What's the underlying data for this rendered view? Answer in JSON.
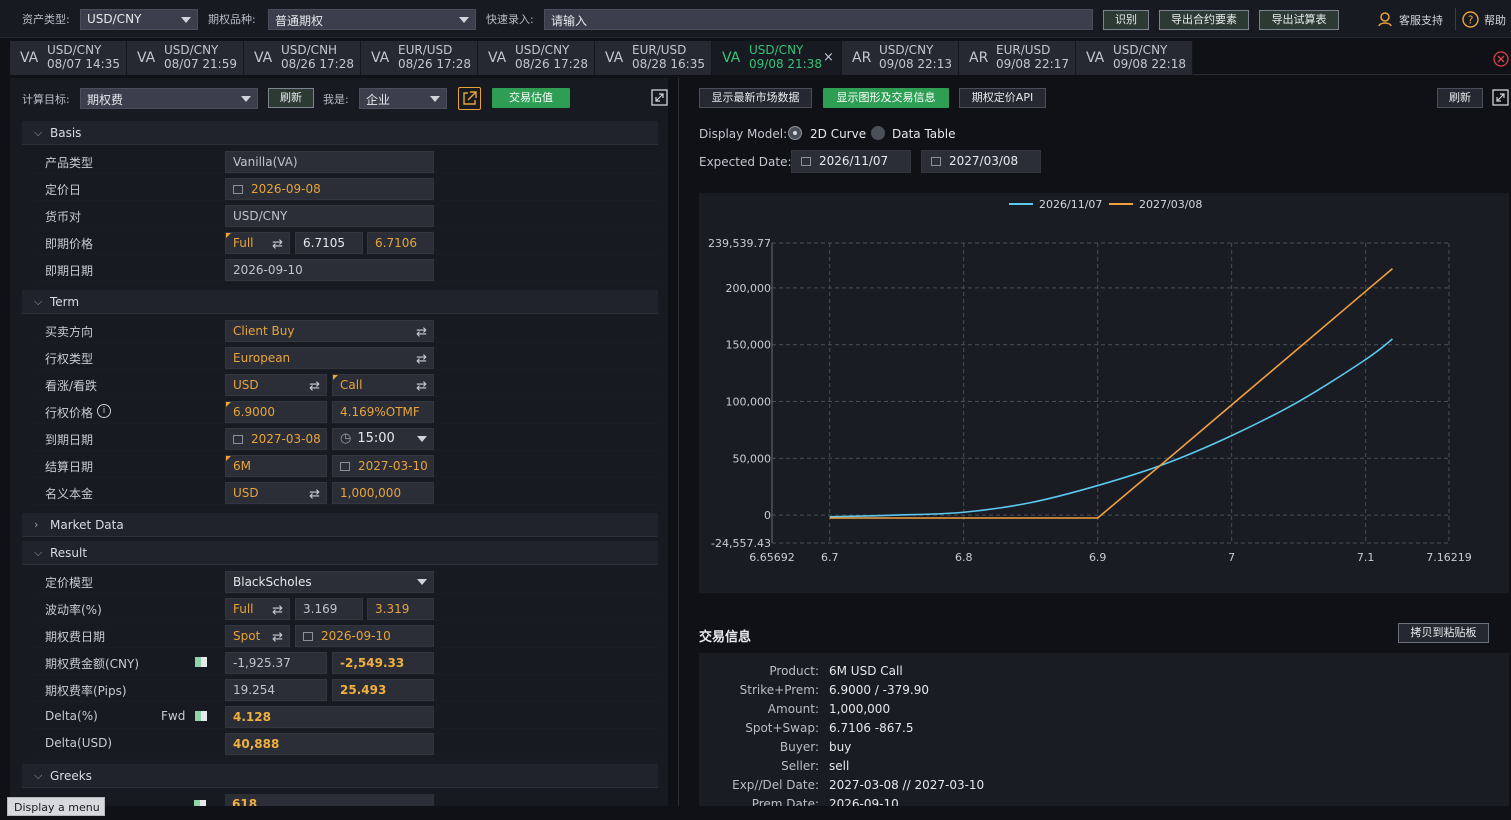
{
  "topbar": {
    "asset_type_label": "资产类型:",
    "asset_type_value": "USD/CNY",
    "option_kind_label": "期权品种:",
    "option_kind_value": "普通期权",
    "quick_entry_label": "快速录入:",
    "quick_entry_placeholder": "请输入",
    "recognize_btn": "识别",
    "export_contract_btn": "导出合约要素",
    "export_trial_btn": "导出试算表",
    "support_label": "客服支持",
    "help_label": "帮助"
  },
  "tabs": [
    {
      "type": "VA",
      "pair": "USD/CNY",
      "time": "08/07 14:35",
      "active": false
    },
    {
      "type": "VA",
      "pair": "USD/CNY",
      "time": "08/07 21:59",
      "active": false
    },
    {
      "type": "VA",
      "pair": "USD/CNH",
      "time": "08/26 17:28",
      "active": false
    },
    {
      "type": "VA",
      "pair": "EUR/USD",
      "time": "08/26 17:28",
      "active": false
    },
    {
      "type": "VA",
      "pair": "USD/CNY",
      "time": "08/26 17:28",
      "active": false
    },
    {
      "type": "VA",
      "pair": "EUR/USD",
      "time": "08/28 16:35",
      "active": false
    },
    {
      "type": "VA",
      "pair": "USD/CNY",
      "time": "09/08 21:38",
      "active": true
    },
    {
      "type": "AR",
      "pair": "USD/CNY",
      "time": "09/08 22:13",
      "active": false
    },
    {
      "type": "AR",
      "pair": "EUR/USD",
      "time": "09/08 22:17",
      "active": false
    },
    {
      "type": "VA",
      "pair": "USD/CNY",
      "time": "09/08 22:18",
      "active": false
    }
  ],
  "left": {
    "calc_target_label": "计算目标:",
    "calc_target_value": "期权费",
    "refresh_btn": "刷新",
    "iam_label": "我是:",
    "iam_value": "企业",
    "trade_eval_btn": "交易估值"
  },
  "basis": {
    "title": "Basis",
    "product_type_label": "产品类型",
    "product_type_value": "Vanilla(VA)",
    "pricing_date_label": "定价日",
    "pricing_date_value": "2026-09-08",
    "currency_pair_label": "货币对",
    "currency_pair_value": "USD/CNY",
    "spot_label": "即期价格",
    "spot_mode": "Full",
    "spot_bid": "6.7105",
    "spot_ask": "6.7106",
    "spot_date_label": "即期日期",
    "spot_date_value": "2026-09-10"
  },
  "term": {
    "title": "Term",
    "direction_label": "买卖方向",
    "direction_value": "Client Buy",
    "exercise_label": "行权类型",
    "exercise_value": "European",
    "callput_label": "看涨/看跌",
    "callput_ccy": "USD",
    "callput_value": "Call",
    "strike_label": "行权价格",
    "strike_value": "6.9000",
    "strike_pct": "4.169%OTMF",
    "expiry_label": "到期日期",
    "expiry_value": "2027-03-08",
    "expiry_time": "15:00",
    "settle_label": "结算日期",
    "settle_tenor": "6M",
    "settle_value": "2027-03-10",
    "notional_label": "名义本金",
    "notional_ccy": "USD",
    "notional_value": "1,000,000"
  },
  "market": {
    "title": "Market Data"
  },
  "result": {
    "title": "Result",
    "model_label": "定价模型",
    "model_value": "BlackScholes",
    "vol_label": "波动率(%)",
    "vol_mode": "Full",
    "vol_bid": "3.169",
    "vol_ask": "3.319",
    "prem_date_label": "期权费日期",
    "prem_date_mode": "Spot",
    "prem_date_value": "2026-09-10",
    "prem_amt_label": "期权费金额(CNY)",
    "prem_amt_bid": "-1,925.37",
    "prem_amt_ask": "-2,549.33",
    "prem_rate_label": "期权费率(Pips)",
    "prem_rate_bid": "19.254",
    "prem_rate_ask": "25.493",
    "delta_pct_label": "Delta(%)",
    "delta_fwd": "Fwd",
    "delta_pct_value": "4.128",
    "delta_usd_label": "Delta(USD)",
    "delta_usd_value": "40,888"
  },
  "greeks": {
    "title": "Greeks",
    "first_value": "618"
  },
  "tooltip": "Display a menu",
  "right": {
    "latest_market_btn": "显示最新市场数据",
    "show_chart_btn": "显示图形及交易信息",
    "api_btn": "期权定价API",
    "refresh_btn": "刷新",
    "display_model_label": "Display Model:",
    "opt_2d": "2D Curve",
    "opt_table": "Data Table",
    "expected_date_label": "Expected Date:",
    "date1": "2026/11/07",
    "date2": "2027/03/08"
  },
  "chart_data": {
    "type": "line",
    "x": [
      6.7,
      6.75,
      6.8,
      6.85,
      6.9,
      6.95,
      7.0,
      7.05,
      7.1,
      7.12
    ],
    "series": [
      {
        "name": "2026/11/07",
        "color": "#5cc8f0",
        "values": [
          -1500,
          0,
          2500,
          11000,
          26000,
          45000,
          70000,
          100000,
          137000,
          155000
        ]
      },
      {
        "name": "2027/03/08",
        "color": "#f0a040",
        "values": [
          -2549,
          -2549,
          -2549,
          -2549,
          -2549,
          47000,
          97000,
          147000,
          197000,
          217000
        ]
      }
    ],
    "xlim": [
      6.65692,
      7.16219
    ],
    "ylim": [
      -24557.43,
      239539.77
    ],
    "x_ticks": [
      "6.65692",
      "6.7",
      "6.8",
      "6.9",
      "7",
      "7.1",
      "7.16219"
    ],
    "y_ticks": [
      "239,539.77",
      "200,000",
      "150,000",
      "100,000",
      "50,000",
      "0",
      "-24,557.43"
    ],
    "legend": "top-center"
  },
  "trade": {
    "title": "交易信息",
    "copy_btn": "拷贝到粘贴板",
    "rows": [
      {
        "k": "Product:",
        "v": "6M USD Call"
      },
      {
        "k": "Strike+Prem:",
        "v": "6.9000 / -379.90"
      },
      {
        "k": "Amount:",
        "v": "1,000,000"
      },
      {
        "k": "Spot+Swap:",
        "v": "6.7106 -867.5"
      },
      {
        "k": "Buyer:",
        "v": "buy"
      },
      {
        "k": "Seller:",
        "v": "sell"
      },
      {
        "k": "Exp//Del Date:",
        "v": "2027-03-08 // 2027-03-10"
      },
      {
        "k": "Prem Date:",
        "v": "2026-09-10"
      }
    ]
  }
}
